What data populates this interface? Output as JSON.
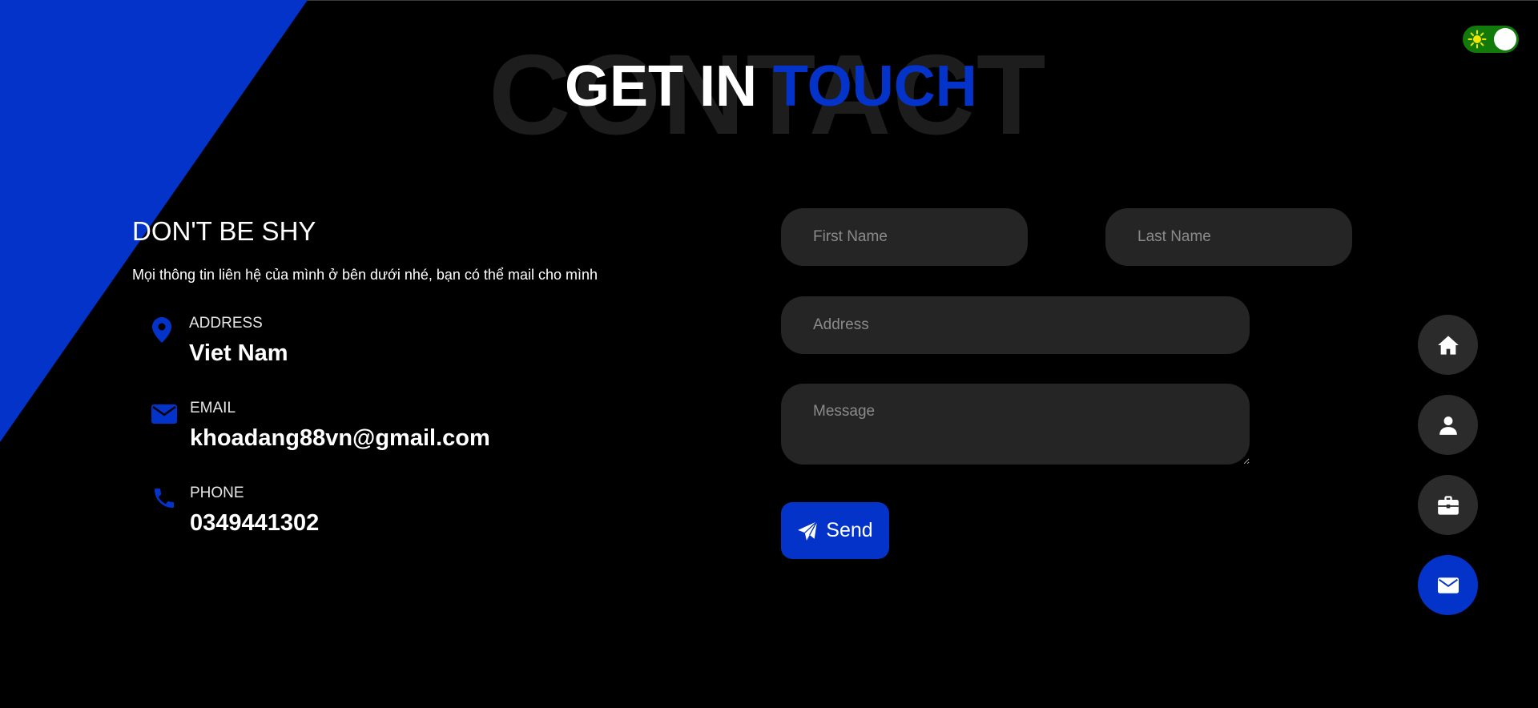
{
  "theme_toggle": {
    "icon": "sun-icon",
    "state": "on",
    "color": "#117a0b"
  },
  "heading": {
    "background_word": "CONTACT",
    "title_white": "GET IN",
    "title_accent": "TOUCH",
    "accent_color": "#0433c9"
  },
  "contact_info": {
    "heading": "DON'T BE SHY",
    "subtitle": "Mọi thông tin liên hệ của mình ở bên dưới nhé, bạn có thể mail cho mình",
    "items": [
      {
        "icon": "map-pin-icon",
        "label": "ADDRESS",
        "value": "Viet Nam"
      },
      {
        "icon": "envelope-icon",
        "label": "EMAIL",
        "value": "khoadang88vn@gmail.com"
      },
      {
        "icon": "phone-icon",
        "label": "PHONE",
        "value": "0349441302"
      }
    ]
  },
  "form": {
    "first_name": {
      "placeholder": "First Name",
      "value": ""
    },
    "last_name": {
      "placeholder": "Last Name",
      "value": ""
    },
    "address": {
      "placeholder": "Address",
      "value": ""
    },
    "message": {
      "placeholder": "Message",
      "value": ""
    },
    "send_label": "Send",
    "send_icon": "paper-plane-icon"
  },
  "side_nav": [
    {
      "icon": "home-icon",
      "active": false
    },
    {
      "icon": "user-icon",
      "active": false
    },
    {
      "icon": "briefcase-icon",
      "active": false
    },
    {
      "icon": "envelope-icon",
      "active": true
    }
  ]
}
